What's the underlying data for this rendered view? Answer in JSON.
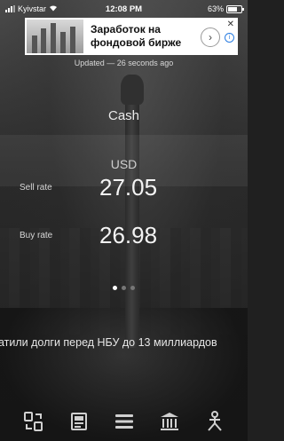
{
  "status_bar": {
    "carrier": "Kyivstar",
    "time": "12:08 PM",
    "battery": "63%"
  },
  "ad": {
    "text": "Заработок на фондовой бирже",
    "close_glyph": "✕",
    "info_glyph": "i",
    "chevron_glyph": "›"
  },
  "updated_text": "Updated — 26 seconds ago",
  "rate_type": "Cash",
  "currency": "USD",
  "sell": {
    "label": "Sell rate",
    "value": "27.05"
  },
  "buy": {
    "label": "Buy rate",
    "value": "26.98"
  },
  "pager": {
    "pages": 3,
    "active": 1
  },
  "ticker_text": "атили долги перед НБУ до 13 миллиардов",
  "bottom_nav": [
    {
      "icon": "converter-icon"
    },
    {
      "icon": "news-icon"
    },
    {
      "icon": "menu-icon"
    },
    {
      "icon": "bank-icon"
    },
    {
      "icon": "atm-icon"
    }
  ]
}
